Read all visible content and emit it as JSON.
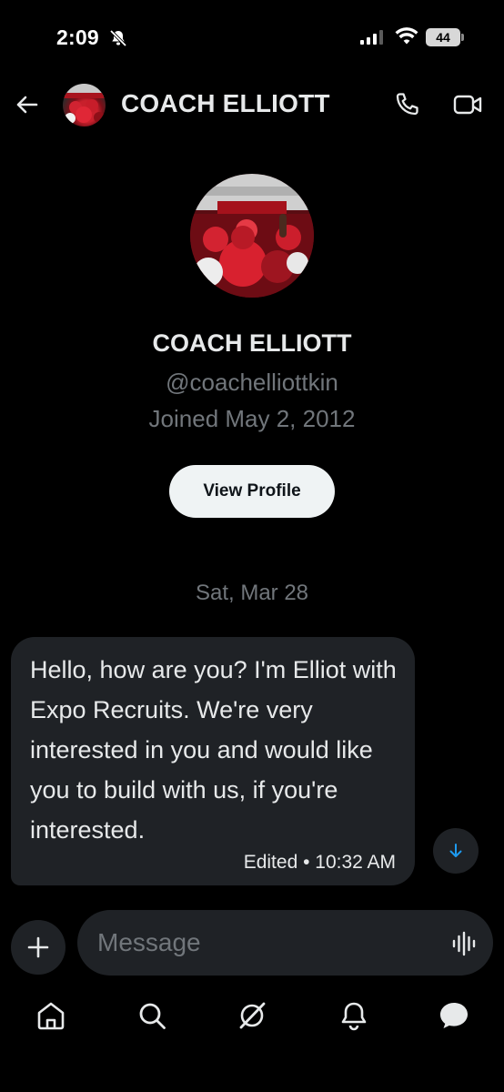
{
  "status_bar": {
    "time": "2:09",
    "battery": "44"
  },
  "header": {
    "title": "COACH ELLIOTT"
  },
  "profile": {
    "name": "COACH ELLIOTT",
    "handle": "@coachelliottkin",
    "joined": "Joined May 2, 2012",
    "view_profile_label": "View Profile"
  },
  "conversation": {
    "date": "Sat, Mar 28",
    "messages": [
      {
        "text": "Hello, how are you? I'm Elliot with Expo Recruits. We're very interested in you and would like you to build with us, if you're interested.",
        "meta": "Edited • 10:32 AM"
      }
    ]
  },
  "composer": {
    "placeholder": "Message"
  },
  "nav": {
    "items": [
      "home-icon",
      "search-icon",
      "grok-icon",
      "notifications-bell-icon",
      "messages-icon"
    ]
  },
  "colors": {
    "background": "#000000",
    "bubble": "#1f2226",
    "muted_text": "#71767b",
    "accent": "#1d9bf0",
    "button_bg": "#eff3f4"
  }
}
